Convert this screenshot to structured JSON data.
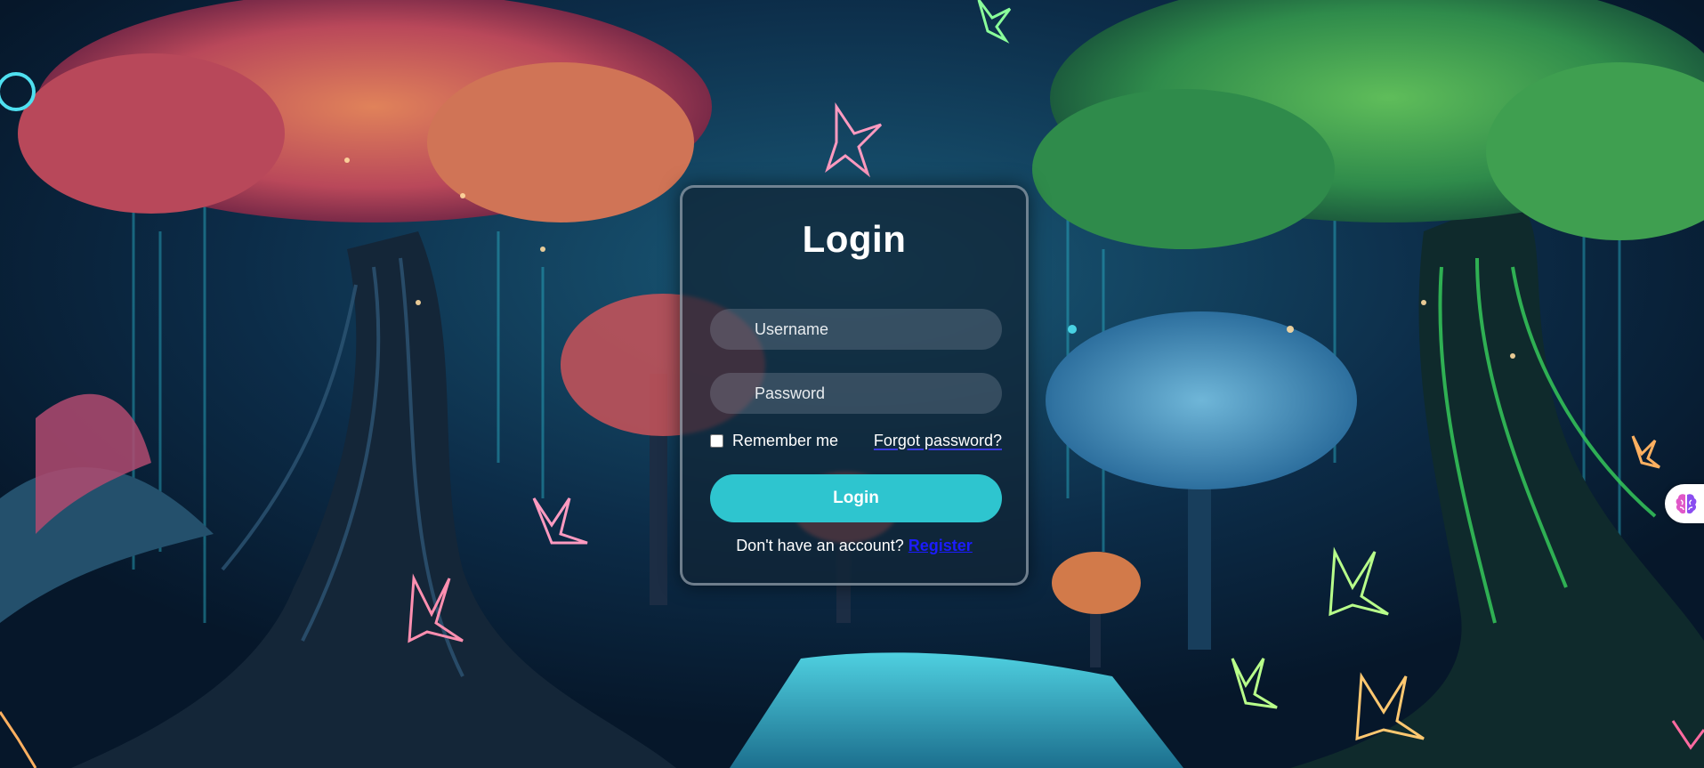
{
  "login": {
    "title": "Login",
    "username_placeholder": "Username",
    "password_placeholder": "Password",
    "remember_label": "Remember me",
    "forgot_label": "Forgot password?",
    "submit_label": "Login",
    "register_prompt": "Don't have an account?",
    "register_label": "Register"
  },
  "widget": {
    "icon": "brain-icon"
  },
  "colors": {
    "accent": "#2ec5cf",
    "link": "#1c1cff",
    "card_bg": "#102434"
  }
}
